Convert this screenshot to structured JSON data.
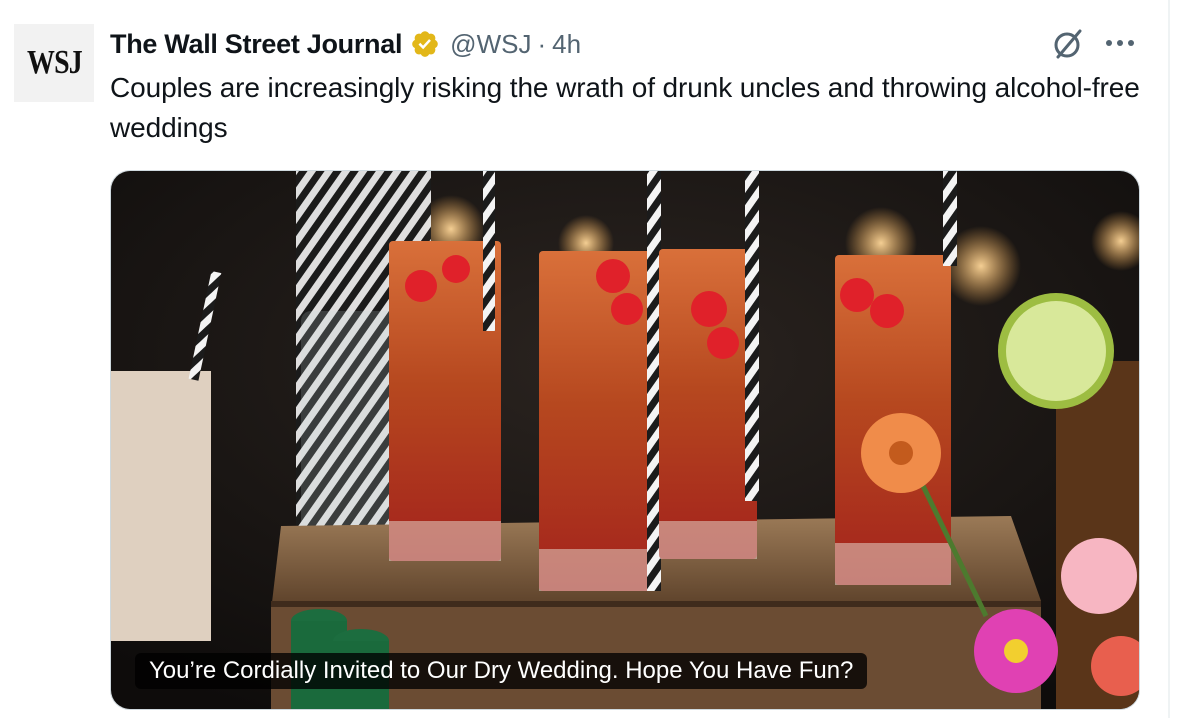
{
  "tweet": {
    "avatar_text": "WSJ",
    "author_name": "The Wall Street Journal",
    "handle": "@WSJ",
    "separator": "·",
    "time": "4h",
    "text": "Couples are increasingly risking the wrath of drunk uncles and throwing alcohol-free weddings",
    "verified_badge_color": "#e2b719"
  },
  "card": {
    "title": "You’re Cordially Invited to Our Dry Wedding. Hope You Have Fun?"
  },
  "icons": {
    "verified": "verified-gold-badge",
    "grok": "grok-icon",
    "more": "more-horizontal-icon"
  }
}
